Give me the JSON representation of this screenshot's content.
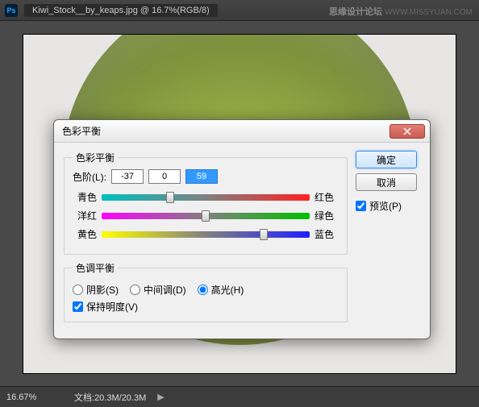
{
  "header": {
    "tab_title": "Kiwi_Stock__by_keaps.jpg @ 16.7%(RGB/8)",
    "watermark_cn": "思缘设计论坛",
    "watermark_url": "WWW.MISSYUAN.COM"
  },
  "dialog": {
    "title": "色彩平衡",
    "group_color_balance": "色彩平衡",
    "level_label": "色阶(L):",
    "levels": {
      "a": "-37",
      "b": "0",
      "c": "59"
    },
    "sliders": {
      "row1": {
        "left": "青色",
        "right": "红色",
        "pos": 33
      },
      "row2": {
        "left": "洋红",
        "right": "绿色",
        "pos": 50
      },
      "row3": {
        "left": "黄色",
        "right": "蓝色",
        "pos": 78
      }
    },
    "group_tone_balance": "色调平衡",
    "radios": {
      "shadows": "阴影(S)",
      "midtones": "中间调(D)",
      "highlights": "高光(H)"
    },
    "preserve_luminosity": "保持明度(V)",
    "ok": "确定",
    "cancel": "取消",
    "preview": "预览(P)"
  },
  "status": {
    "zoom": "16.67%",
    "doc_label": "文档:",
    "doc_value": "20.3M/20.3M"
  }
}
